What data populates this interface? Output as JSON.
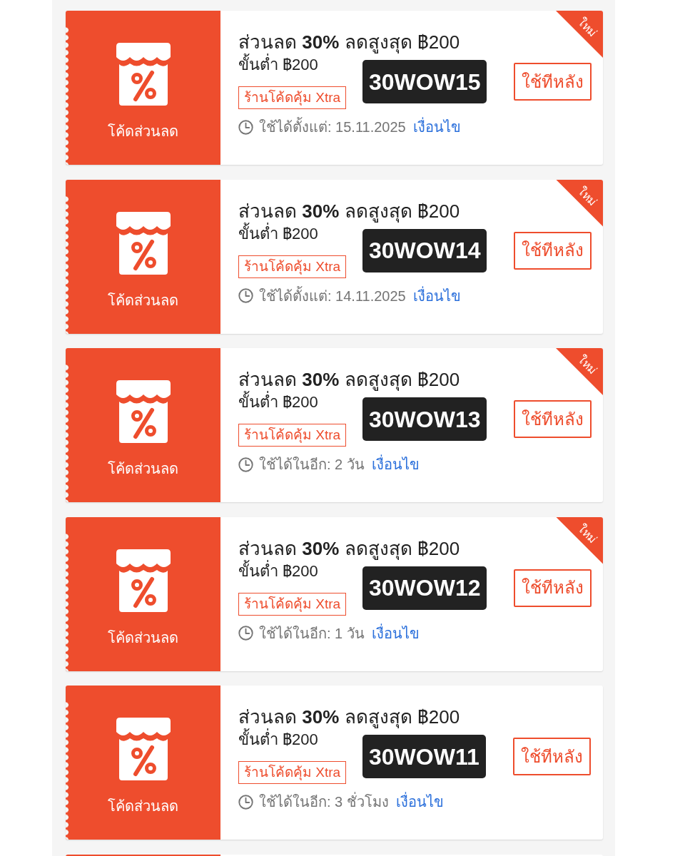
{
  "coupons": [
    {
      "stub_label": "โค้ดส่วนลด",
      "title": "ส่วนลด **30%** ลดสูงสุด ฿200",
      "min_spend": "ขั้นต่ำ ฿200",
      "tag": "ร้านโค้ดคุ้ม Xtra",
      "code": "30WOW15",
      "button": "ใช้ทีหลัง",
      "validity": "ใช้ได้ตั้งแต่: 15.11.2025",
      "terms_link": "เงื่อนไข",
      "ribbon": "ใหม่"
    },
    {
      "stub_label": "โค้ดส่วนลด",
      "title": "ส่วนลด **30%** ลดสูงสุด ฿200",
      "min_spend": "ขั้นต่ำ ฿200",
      "tag": "ร้านโค้ดคุ้ม Xtra",
      "code": "30WOW14",
      "button": "ใช้ทีหลัง",
      "validity": "ใช้ได้ตั้งแต่: 14.11.2025",
      "terms_link": "เงื่อนไข",
      "ribbon": "ใหม่"
    },
    {
      "stub_label": "โค้ดส่วนลด",
      "title": "ส่วนลด **30%** ลดสูงสุด ฿200",
      "min_spend": "ขั้นต่ำ ฿200",
      "tag": "ร้านโค้ดคุ้ม Xtra",
      "code": "30WOW13",
      "button": "ใช้ทีหลัง",
      "validity": "ใช้ได้ในอีก: 2 วัน",
      "terms_link": "เงื่อนไข",
      "ribbon": "ใหม่"
    },
    {
      "stub_label": "โค้ดส่วนลด",
      "title": "ส่วนลด **30%** ลดสูงสุด ฿200",
      "min_spend": "ขั้นต่ำ ฿200",
      "tag": "ร้านโค้ดคุ้ม Xtra",
      "code": "30WOW12",
      "button": "ใช้ทีหลัง",
      "validity": "ใช้ได้ในอีก: 1 วัน",
      "terms_link": "เงื่อนไข",
      "ribbon": "ใหม่"
    },
    {
      "stub_label": "โค้ดส่วนลด",
      "title": "ส่วนลด **30%** ลดสูงสุด ฿200",
      "min_spend": "ขั้นต่ำ ฿200",
      "tag": "ร้านโค้ดคุ้ม Xtra",
      "code": "30WOW11",
      "button": "ใช้ทีหลัง",
      "validity": "ใช้ได้ในอีก: 3 ชั่วโมง",
      "terms_link": "เงื่อนไข"
    }
  ]
}
